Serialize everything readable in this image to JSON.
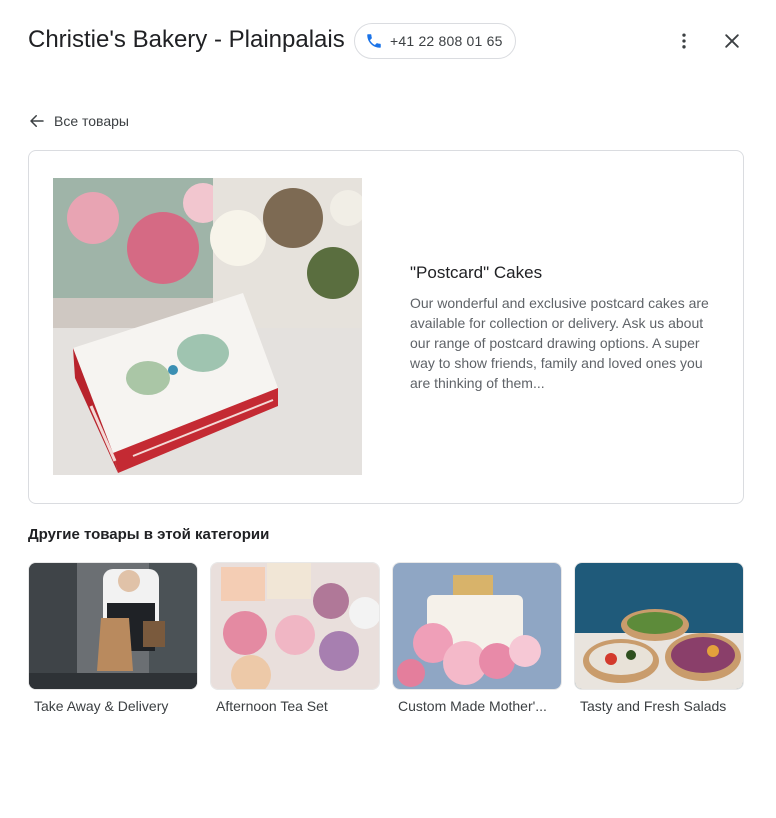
{
  "header": {
    "title": "Christie's Bakery - Plainpalais",
    "phone": "+41 22 808 01 65",
    "phone_icon": "phone-icon",
    "more_icon": "more-vert-icon",
    "close_icon": "close-icon"
  },
  "nav": {
    "back_label": "Все товары",
    "back_icon": "arrow-back-icon"
  },
  "product": {
    "name": "\"Postcard\" Cakes",
    "description": "Our wonderful and exclusive postcard cakes are available for collection or delivery. Ask us about our range of postcard drawing options. A super way to show friends, family and loved ones you are thinking of them..."
  },
  "related": {
    "title": "Другие товары в этой категории",
    "items": [
      {
        "label": "Take Away & Delivery"
      },
      {
        "label": "Afternoon Tea Set"
      },
      {
        "label": "Custom Made Mother'..."
      },
      {
        "label": "Tasty and Fresh Salads"
      }
    ]
  },
  "colors": {
    "accent": "#1a73e8",
    "text_primary": "#202124",
    "text_secondary": "#5f6368",
    "border": "#dadce0"
  }
}
